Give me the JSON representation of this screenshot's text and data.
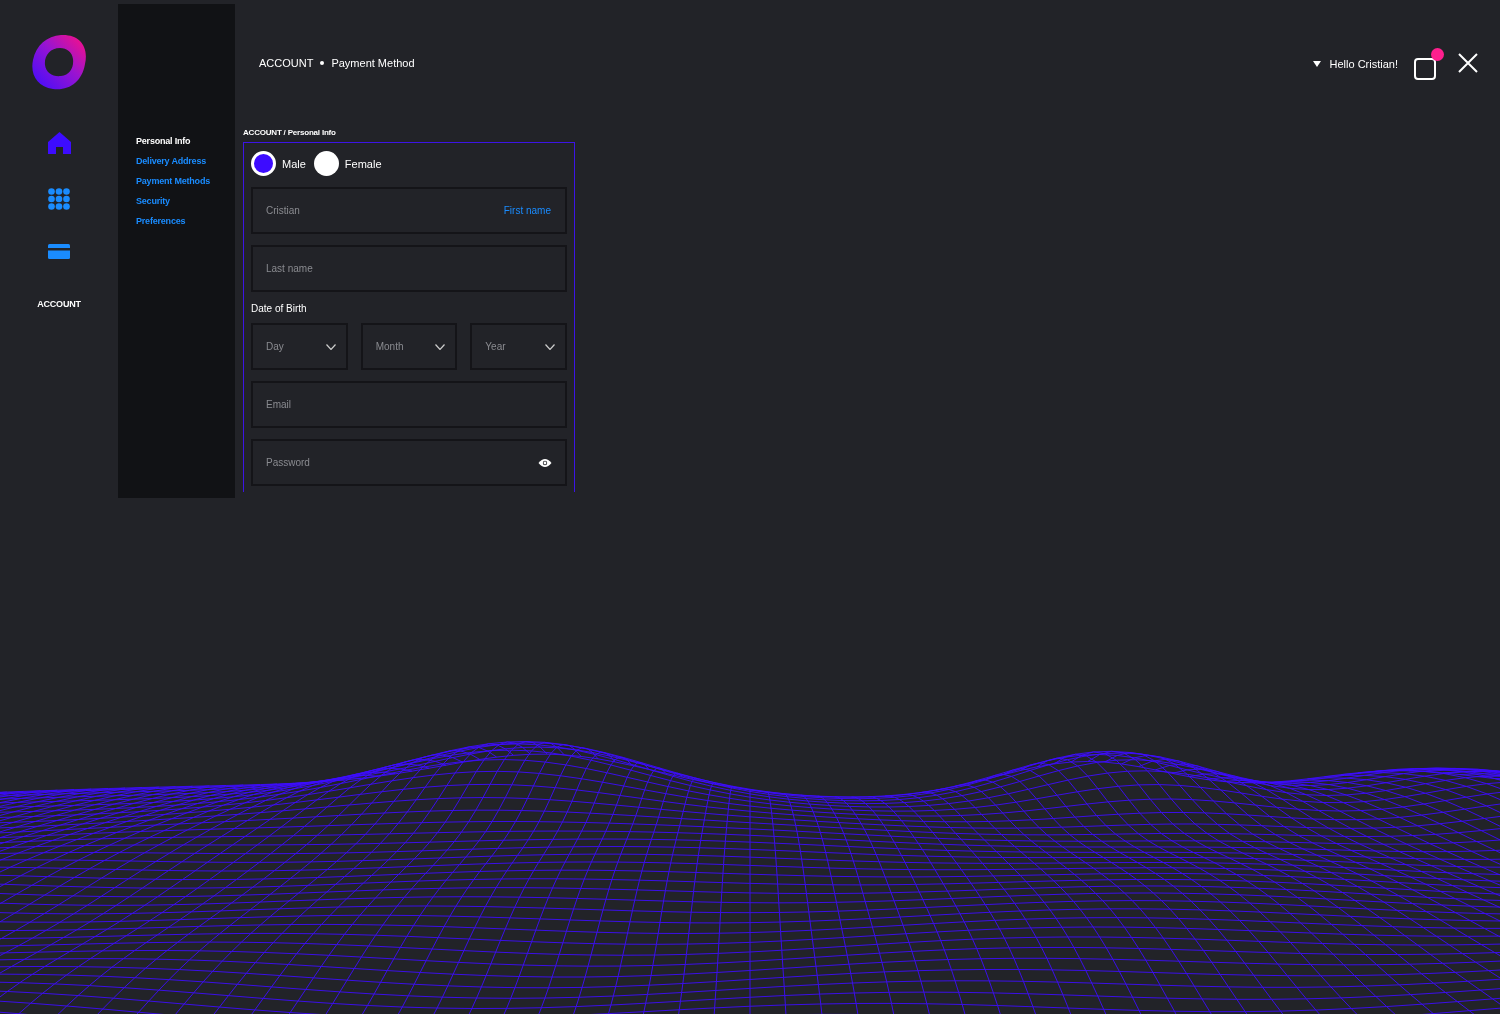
{
  "breadcrumb": {
    "section": "ACCOUNT",
    "page": "Payment Method"
  },
  "nav_rail": [
    {
      "kind": "home"
    },
    {
      "kind": "grid"
    },
    {
      "kind": "card"
    },
    {
      "kind": "account",
      "label": "ACCOUNT"
    }
  ],
  "user_menu": {
    "greeting": "Hello Cristian!",
    "has_notification": true
  },
  "submenu": [
    {
      "label": "Personal Info",
      "selected": true
    },
    {
      "label": "Delivery Address",
      "selected": false
    },
    {
      "label": "Payment Methods",
      "selected": false
    },
    {
      "label": "Security",
      "selected": false
    },
    {
      "label": "Preferences",
      "selected": false
    }
  ],
  "form": {
    "title": "ACCOUNT / Personal Info",
    "gender": [
      {
        "label": "Male",
        "selected": true
      },
      {
        "label": "Female",
        "selected": false
      }
    ],
    "first_name": {
      "value": "Cristian",
      "label": "First name"
    },
    "last_name": {
      "placeholder": "Last name"
    },
    "dob_label": "Date of Birth",
    "dob": [
      {
        "placeholder": "Day"
      },
      {
        "placeholder": "Month"
      },
      {
        "placeholder": "Year"
      }
    ],
    "email": {
      "placeholder": "Email"
    },
    "password": {
      "placeholder": "Password"
    }
  }
}
